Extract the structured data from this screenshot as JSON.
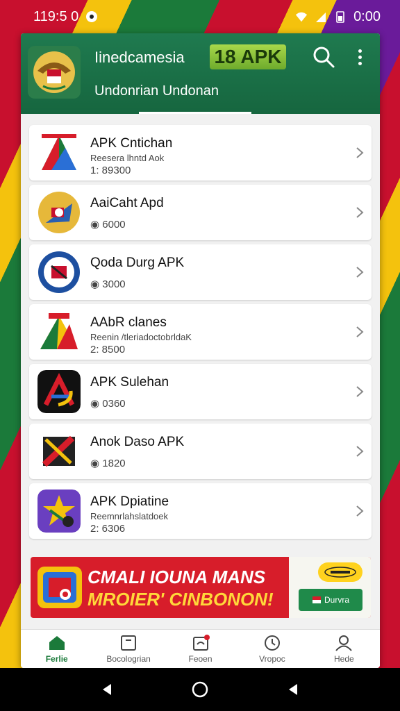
{
  "status_bar": {
    "time": "119:5 0",
    "battery_time": "0:00"
  },
  "header": {
    "title": "Iinedcamesia",
    "badge": "18 APK",
    "subtitle": "Undonrian Undonan"
  },
  "items": [
    {
      "title": "APK Cntichan",
      "sub": "Reesera lhntd Aok",
      "count": "1: 89300",
      "icon": "triangle-logo-icon"
    },
    {
      "title": "AaiCaht Apd",
      "sub": "",
      "count": "6000",
      "icon": "gold-emblem-icon"
    },
    {
      "title": "Qoda Durg APK",
      "sub": "",
      "count": "3000",
      "icon": "blue-seal-icon"
    },
    {
      "title": "AAbR clanes",
      "sub": "Reenin /tleriadoctobrldaK",
      "count": "2: 8500",
      "icon": "color-triangle-icon"
    },
    {
      "title": "APK Sulehan",
      "sub": "",
      "count": "0360",
      "icon": "a-logo-icon"
    },
    {
      "title": "Anok Daso APK",
      "sub": "",
      "count": "1820",
      "icon": "x-logo-icon"
    },
    {
      "title": "APK Dpiatine",
      "sub": "Reemnrlahslatdoek",
      "count": "2: 6306",
      "icon": "purple-star-icon"
    }
  ],
  "banner": {
    "line1": "CMALI IOUNA MANS",
    "line2": "MROIER' CINBONON!",
    "cta": "Durvra"
  },
  "bottom_nav": [
    {
      "label": "Ferlie",
      "icon": "home-icon",
      "active": true
    },
    {
      "label": "Bocologrian",
      "icon": "tablet-icon",
      "active": false
    },
    {
      "label": "Feoen",
      "icon": "notification-icon",
      "active": false
    },
    {
      "label": "Vropoc",
      "icon": "clock-icon",
      "active": false
    },
    {
      "label": "Hede",
      "icon": "profile-icon",
      "active": false
    }
  ],
  "colors": {
    "header": "#1f7a4f",
    "accent": "#1b7a3a",
    "banner": "#d71d2a"
  }
}
